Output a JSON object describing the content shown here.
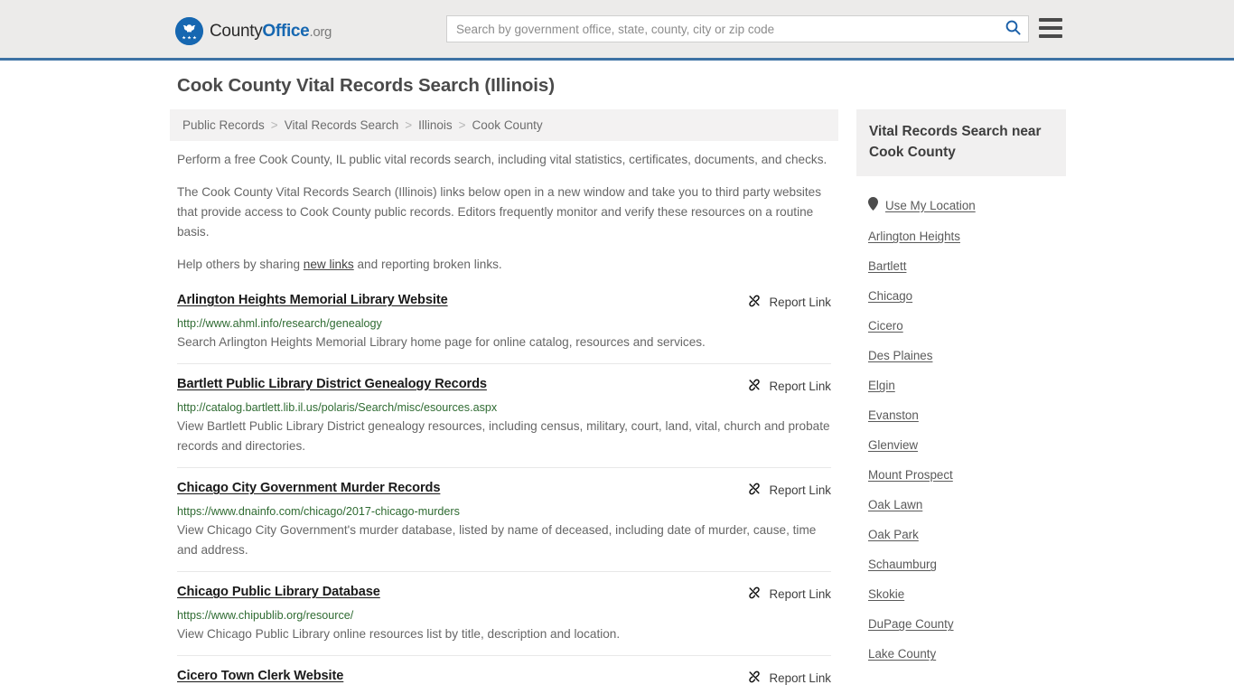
{
  "header": {
    "logo": {
      "icon": "eagle-seal-icon",
      "text_county": "County",
      "text_office": "Office",
      "text_org": ".org"
    },
    "search": {
      "placeholder": "Search by government office, state, county, city or zip code",
      "value": "",
      "icon": "search-icon"
    },
    "menu_icon": "hamburger-menu-icon",
    "accent_color": "#3d72a4",
    "background_color": "#ecebea"
  },
  "page_title": "Cook County Vital Records Search (Illinois)",
  "breadcrumb": {
    "separator": ">",
    "items": [
      {
        "label": "Public Records"
      },
      {
        "label": "Vital Records Search"
      },
      {
        "label": "Illinois"
      },
      {
        "label": "Cook County"
      }
    ]
  },
  "intro": {
    "paragraph1": "Perform a free Cook County, IL public vital records search, including vital statistics, certificates, documents, and checks.",
    "paragraph2": "The Cook County Vital Records Search (Illinois) links below open in a new window and take you to third party websites that provide access to Cook County public records. Editors frequently monitor and verify these resources on a routine basis.",
    "paragraph3_before": "Help others by sharing ",
    "paragraph3_link": "new links",
    "paragraph3_after": " and reporting broken links."
  },
  "results": {
    "report_label": "Report Link",
    "report_icon": "broken-link-icon",
    "url_color": "#2f6b32",
    "items": [
      {
        "title": "Arlington Heights Memorial Library Website",
        "url": "http://www.ahml.info/research/genealogy",
        "description": "Search Arlington Heights Memorial Library home page for online catalog, resources and services."
      },
      {
        "title": "Bartlett Public Library District Genealogy Records",
        "url": "http://catalog.bartlett.lib.il.us/polaris/Search/misc/esources.aspx",
        "description": "View Bartlett Public Library District genealogy resources, including census, military, court, land, vital, church and probate records and directories."
      },
      {
        "title": "Chicago City Government Murder Records",
        "url": "https://www.dnainfo.com/chicago/2017-chicago-murders",
        "description": "View Chicago City Government's murder database, listed by name of deceased, including date of murder, cause, time and address."
      },
      {
        "title": "Chicago Public Library Database",
        "url": "https://www.chipublib.org/resource/",
        "description": "View Chicago Public Library online resources list by title, description and location."
      },
      {
        "title": "Cicero Town Clerk Website",
        "url": "",
        "description": ""
      }
    ]
  },
  "sidebar": {
    "heading": "Vital Records Search near Cook County",
    "use_my_location": {
      "label": "Use My Location",
      "icon": "map-pin-icon"
    },
    "links": [
      {
        "label": "Arlington Heights"
      },
      {
        "label": "Bartlett"
      },
      {
        "label": "Chicago"
      },
      {
        "label": "Cicero"
      },
      {
        "label": "Des Plaines"
      },
      {
        "label": "Elgin"
      },
      {
        "label": "Evanston"
      },
      {
        "label": "Glenview"
      },
      {
        "label": "Mount Prospect"
      },
      {
        "label": "Oak Lawn"
      },
      {
        "label": "Oak Park"
      },
      {
        "label": "Schaumburg"
      },
      {
        "label": "Skokie"
      },
      {
        "label": "DuPage County"
      },
      {
        "label": "Lake County"
      }
    ]
  }
}
